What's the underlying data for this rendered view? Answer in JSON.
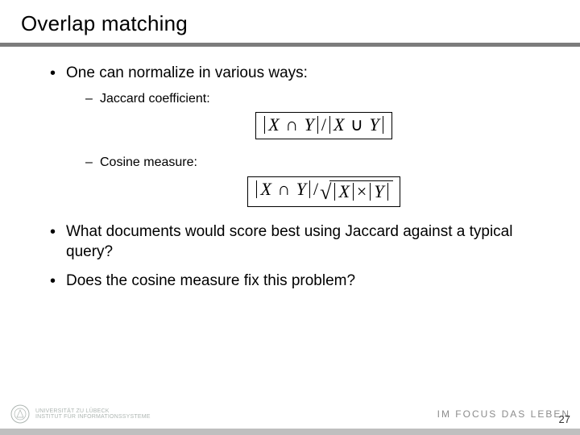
{
  "slide": {
    "title": "Overlap matching",
    "bullets": {
      "b1": "One can normalize in various ways:",
      "b1a": "Jaccard coefficient:",
      "b1b": "Cosine measure:",
      "b2": "What documents would score best using Jaccard against a typical query?",
      "b3": "Does the cosine measure fix this problem?"
    },
    "formulas": {
      "jaccard_tex": "|X ∩ Y| / |X ∪ Y|",
      "cosine_tex": "|X ∩ Y| / √(|X| × |Y|)",
      "parts": {
        "X": "X",
        "Y": "Y",
        "cap": "∩",
        "cup": "∪",
        "times": "×",
        "slash": "/"
      }
    }
  },
  "footer": {
    "university_line1": "UNIVERSITÄT ZU LÜBECK",
    "university_line2": "INSTITUT FÜR INFORMATIONSSYSTEME",
    "motto": "IM FOCUS DAS LEBEN",
    "page_number": "27"
  },
  "colors": {
    "rule": "#7c7c7c",
    "footer_bar": "#bfbfbf",
    "motto": "#8c8c8c",
    "logo": "#6b7a73"
  }
}
